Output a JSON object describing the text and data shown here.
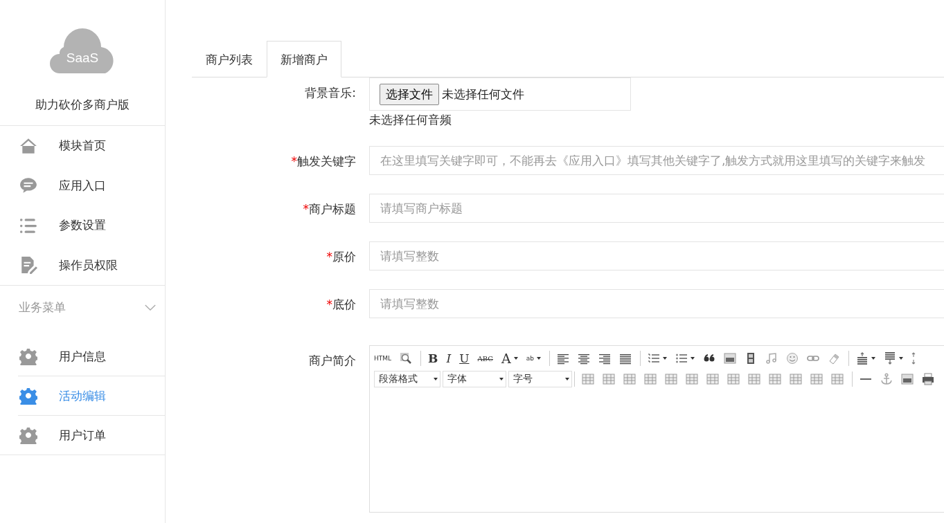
{
  "sidebar": {
    "logo": {
      "text": "SaaS"
    },
    "app_title": "助力砍价多商户版",
    "items": [
      {
        "label": "模块首页",
        "kind": "home",
        "selected": false
      },
      {
        "label": "应用入口",
        "kind": "chat",
        "selected": false
      },
      {
        "label": "参数设置",
        "kind": "list",
        "selected": false
      },
      {
        "label": "操作员权限",
        "kind": "doc",
        "selected": false
      }
    ],
    "section": {
      "label": "业务菜单",
      "expanded": true,
      "items": [
        {
          "label": "用户信息",
          "kind": "gear",
          "selected": false
        },
        {
          "label": "活动编辑",
          "kind": "gear",
          "selected": true
        },
        {
          "label": "用户订单",
          "kind": "gear",
          "selected": false
        }
      ]
    }
  },
  "tabs": [
    {
      "label": "商户列表",
      "selected": false
    },
    {
      "label": "新增商户",
      "selected": true
    }
  ],
  "form": {
    "music": {
      "label": "背景音乐:",
      "button": "选择文件",
      "file_status": "未选择任何文件",
      "hint": "未选择任何音频"
    },
    "fields": [
      {
        "required_mark": "*",
        "label": "触发关键字",
        "placeholder": "在这里填写关键字即可，不能再去《应用入口》填写其他关键字了,触发方式就用这里填写的关键字来触发"
      },
      {
        "required_mark": "*",
        "label": "商户标题",
        "placeholder": "请填写商户标题"
      },
      {
        "required_mark": "*",
        "label": "原价",
        "placeholder": "请填写整数"
      },
      {
        "required_mark": "*",
        "label": "底价",
        "placeholder": "请填写整数"
      }
    ],
    "editor": {
      "label": "商户简介",
      "toolbar_row_1": [
        {
          "kind": "html",
          "label": "HTML"
        },
        {
          "kind": "preview"
        },
        {
          "kind": "sep"
        },
        {
          "kind": "bold",
          "label": "B"
        },
        {
          "kind": "italic",
          "label": "I"
        },
        {
          "kind": "underline",
          "label": "U"
        },
        {
          "kind": "strike",
          "label": "ABC"
        },
        {
          "kind": "fontcolor",
          "label": "A"
        },
        {
          "kind": "highlight",
          "label": "ab"
        },
        {
          "kind": "sep"
        },
        {
          "kind": "alignleft"
        },
        {
          "kind": "aligncenter"
        },
        {
          "kind": "alignright"
        },
        {
          "kind": "alignjustify"
        },
        {
          "kind": "sep"
        },
        {
          "kind": "orderedlist"
        },
        {
          "kind": "bulletlist"
        },
        {
          "kind": "quote"
        },
        {
          "kind": "image"
        },
        {
          "kind": "film"
        },
        {
          "kind": "music"
        },
        {
          "kind": "face"
        },
        {
          "kind": "link"
        },
        {
          "kind": "eraser"
        },
        {
          "kind": "sep"
        },
        {
          "kind": "spaceabove"
        },
        {
          "kind": "spacebelow"
        },
        {
          "kind": "updown"
        }
      ],
      "toolbar_row_2": [
        {
          "kind": "select",
          "label": "段落格式"
        },
        {
          "kind": "select",
          "label": "字体"
        },
        {
          "kind": "select",
          "label": "字号"
        },
        {
          "kind": "sep"
        },
        {
          "kind": "table"
        },
        {
          "kind": "table"
        },
        {
          "kind": "table"
        },
        {
          "kind": "table"
        },
        {
          "kind": "table"
        },
        {
          "kind": "table"
        },
        {
          "kind": "table"
        },
        {
          "kind": "table"
        },
        {
          "kind": "table"
        },
        {
          "kind": "table"
        },
        {
          "kind": "table"
        },
        {
          "kind": "table"
        },
        {
          "kind": "table"
        },
        {
          "kind": "sep"
        },
        {
          "kind": "hr"
        },
        {
          "kind": "anchor"
        },
        {
          "kind": "image"
        },
        {
          "kind": "print"
        }
      ]
    }
  }
}
